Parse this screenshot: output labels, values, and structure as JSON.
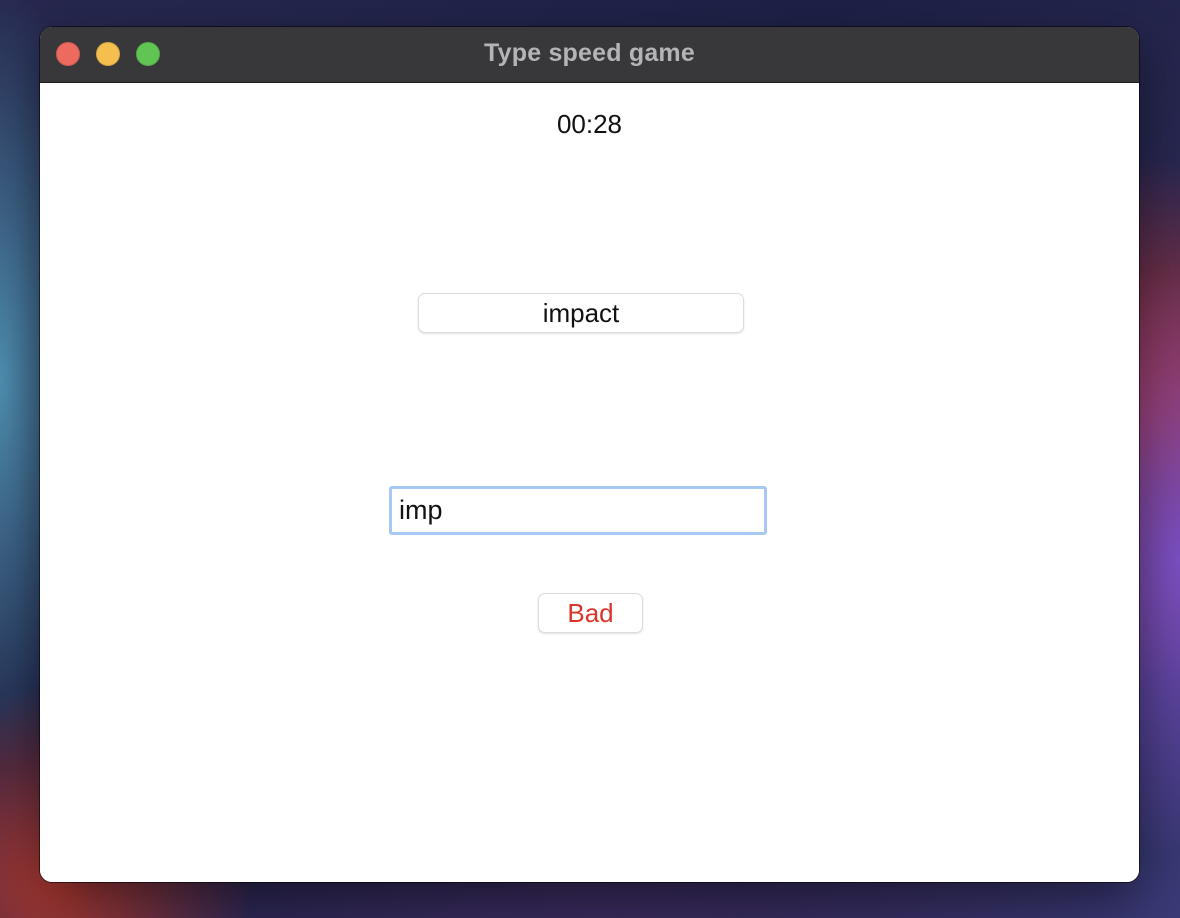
{
  "window": {
    "title": "Type speed game"
  },
  "game": {
    "timer": "00:28",
    "target_word": "impact",
    "typed_value": "imp",
    "result": "Bad",
    "result_color": "#d9342b"
  },
  "icons": {
    "close": "close-traffic-light-icon",
    "minimize": "minimize-traffic-light-icon",
    "zoom": "zoom-traffic-light-icon"
  },
  "colors": {
    "close": "#ed6a5e",
    "minimize": "#f5bf4f",
    "zoom": "#61c554",
    "input_focus_ring": "#a6c8f2"
  }
}
